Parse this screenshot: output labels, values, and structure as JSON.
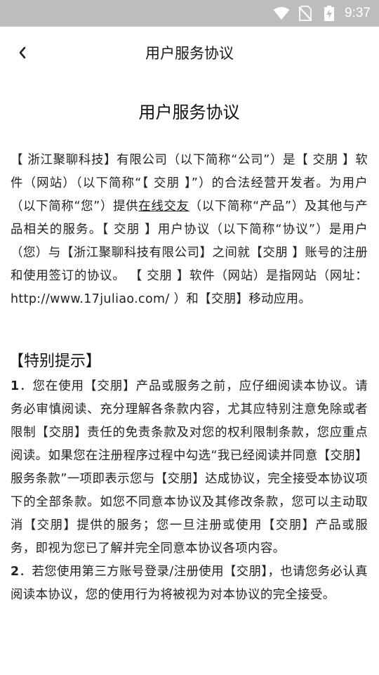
{
  "status_bar": {
    "time": "9:37",
    "icons": [
      "wifi-icon",
      "no-sim-icon",
      "battery-charging-icon"
    ]
  },
  "app_bar": {
    "back_icon": "chevron-left-icon",
    "title": "用户服务协议"
  },
  "document": {
    "title": "用户服务协议",
    "intro": {
      "part1": "【 浙江聚聊科技】有限公司（以下简称“公司”）是【 交朋 】软件（网站）（以下简称“【 交朋 】”）的合法经营开发者。为用户（以下简称“您”）提供",
      "link": "在线交友",
      "part2": "（以下简称“产品”）及其他与产品相关的服务。【 交朋 】用户协议（以下简称“协议”）是用户（您）与【浙江聚聊科技有限公司】之间就【交朋 】账号的注册和使用签订的协议。 【 交朋 】软件（网站）是指网站（网址：http://www.17juliao.com/ ）和【交朋】移动应用。"
    },
    "section": {
      "heading": "【特别提示】",
      "items": [
        {
          "number": "1",
          "text": "．您在使用【交朋】产品或服务之前，应仔细阅读本协议。请务必审慎阅读、充分理解各条款内容，尤其应特别注意免除或者限制【交朋】责任的免责条款及对您的权利限制条款，您应重点阅读。如果您在注册程序过程中勾选“我已经阅读并同意【交朋】服务条款”一项即表示您与【交朋】达成协议，完全接受本协议项下的全部条款。如您不同意本协议及其修改条款，您可以主动取消【交朋】提供的服务；您一旦注册或使用【交朋】产品或服务，即视为您已了解并完全同意本协议各项内容。"
        },
        {
          "number": "2",
          "text": "．若您使用第三方账号登录/注册使用【交朋】，也请您务必认真阅读本协议，您的使用行为将被视为对本协议的完全接受。"
        }
      ]
    }
  }
}
